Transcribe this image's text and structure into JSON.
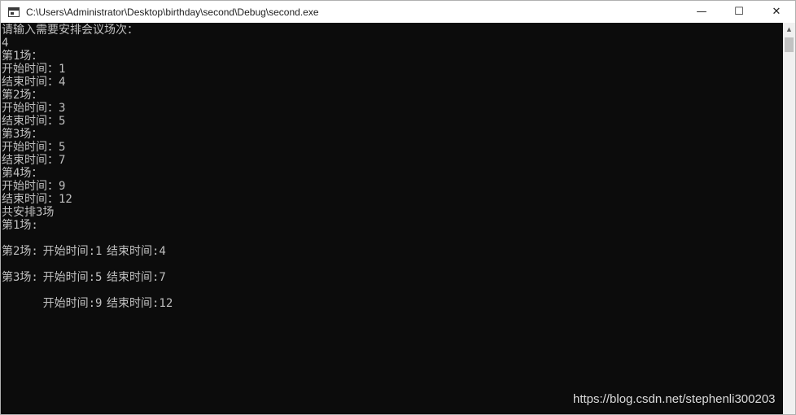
{
  "window": {
    "title": "C:\\Users\\Administrator\\Desktop\\birthday\\second\\Debug\\second.exe",
    "app_icon": "console-window-icon",
    "controls": {
      "minimize_glyph": "—",
      "maximize_glyph": "☐",
      "close_glyph": "✕"
    }
  },
  "console": {
    "lines": [
      "请输入需要安排会议场次：",
      "4",
      "第1场：",
      "开始时间：1",
      "结束时间：4",
      "第2场：",
      "开始时间：3",
      "结束时间：5",
      "第3场：",
      "开始时间：5",
      "结束时间：7",
      "第4场：",
      "开始时间：9",
      "结束时间：12",
      "共安排3场",
      "第1场:",
      "开始时间:1",
      "第2场:",
      "开始时间:5",
      "第3场:",
      "开始时间:9"
    ],
    "end_times": [
      "结束时间:4",
      "结束时间:7",
      "结束时间:12"
    ]
  },
  "scrollbar": {
    "up_arrow_glyph": "▲"
  },
  "watermark": "https://blog.csdn.net/stephenli300203",
  "colors": {
    "console_bg": "#0c0c0c",
    "console_text": "#c0c0c0",
    "titlebar_bg": "#ffffff"
  }
}
